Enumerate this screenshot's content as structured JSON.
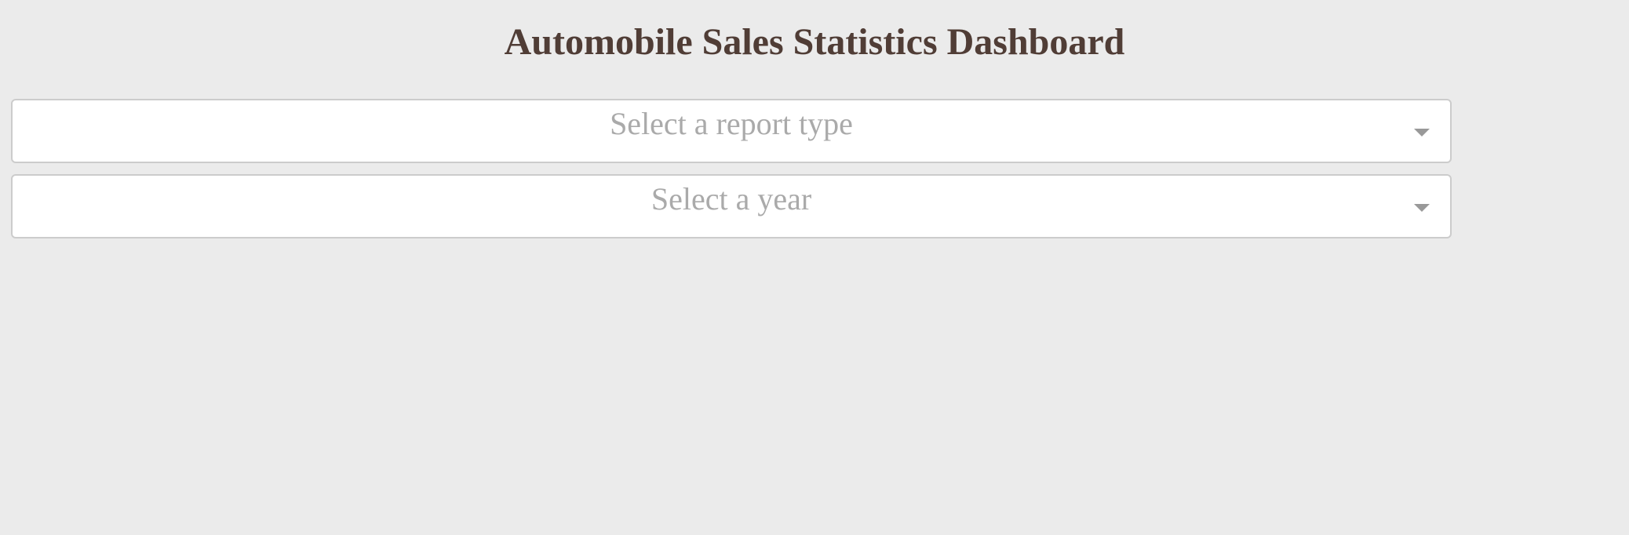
{
  "header": {
    "title": "Automobile Sales Statistics Dashboard"
  },
  "filters": {
    "report_type": {
      "placeholder": "Select a report type",
      "selected_value": "",
      "icon": "chevron-down-icon"
    },
    "year": {
      "placeholder": "Select a year",
      "selected_value": "",
      "icon": "chevron-down-icon"
    }
  },
  "colors": {
    "background": "#ebebeb",
    "title": "#503d36",
    "placeholder": "#aaaaaa",
    "dropdown_border": "#cccccc",
    "arrow": "#999999"
  }
}
